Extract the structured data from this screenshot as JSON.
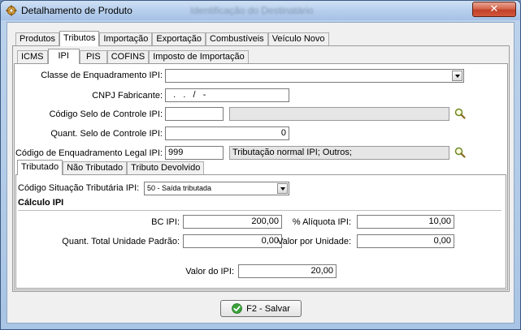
{
  "window": {
    "title": "Detalhamento de Produto",
    "background_title": "Identificação do Destinatário",
    "close_glyph": "✕"
  },
  "main_tabs": [
    {
      "label": "Produtos",
      "active": false
    },
    {
      "label": "Tributos",
      "active": true
    },
    {
      "label": "Importação",
      "active": false
    },
    {
      "label": "Exportação",
      "active": false
    },
    {
      "label": "Combustíveis",
      "active": false
    },
    {
      "label": "Veículo Novo",
      "active": false
    }
  ],
  "tax_tabs": [
    {
      "label": "ICMS",
      "active": false
    },
    {
      "label": "IPI",
      "active": true
    },
    {
      "label": "PIS",
      "active": false
    },
    {
      "label": "COFINS",
      "active": false
    },
    {
      "label": "Imposto de Importação",
      "active": false
    }
  ],
  "ipi": {
    "classe_label": "Classe de Enquadramento IPI:",
    "classe_value": "",
    "cnpj_label": "CNPJ Fabricante:",
    "cnpj_value": "  .   .   /   -",
    "selo_label": "Código Selo de Controle IPI:",
    "selo_code": "",
    "selo_desc": "",
    "quant_selo_label": "Quant. Selo de Controle IPI:",
    "quant_selo_value": "0",
    "enq_legal_label": "Código de Enquadramento Legal IPI:",
    "enq_legal_code": "999",
    "enq_legal_desc": "Tributação normal IPI; Outros;"
  },
  "sub_tabs": [
    {
      "label": "Tributado",
      "active": true
    },
    {
      "label": "Não Tributado",
      "active": false
    },
    {
      "label": "Tributo Devolvido",
      "active": false
    }
  ],
  "tributado": {
    "cst_label": "Código Situação Tributária IPI:",
    "cst_value": "50 - Saída tributada",
    "section_title": "Cálculo IPI",
    "bc_label": "BC IPI:",
    "bc_value": "200,00",
    "aliquota_label": "% Alíquota IPI:",
    "aliquota_value": "10,00",
    "quant_total_label": "Quant. Total Unidade Padrão:",
    "quant_total_value": "0,00",
    "valor_unidade_label": "Valor por Unidade:",
    "valor_unidade_value": "0,00",
    "valor_ipi_label": "Valor do IPI:",
    "valor_ipi_value": "20,00"
  },
  "footer": {
    "save_label": "F2 - Salvar"
  },
  "colors": {
    "accent_green": "#3aa23a",
    "close_red": "#c2412a"
  }
}
